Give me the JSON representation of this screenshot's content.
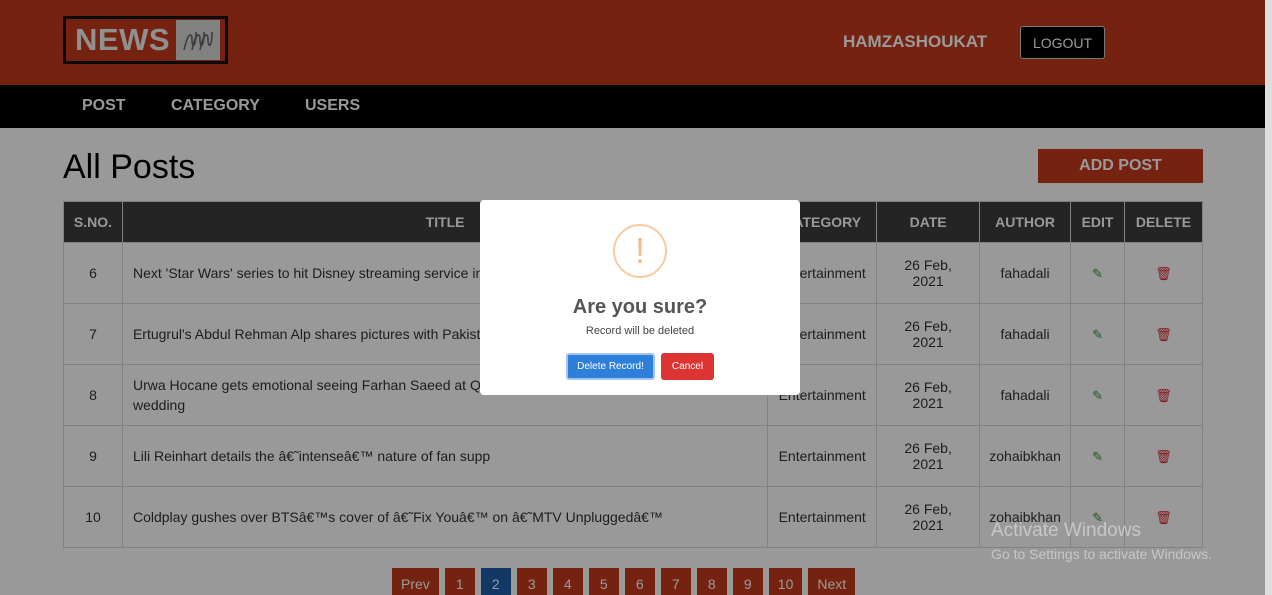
{
  "header": {
    "logo_text": "NEWS",
    "username": "HAMZASHOUKAT",
    "logout_label": "LOGOUT"
  },
  "nav": {
    "items": [
      {
        "label": "POST"
      },
      {
        "label": "CATEGORY"
      },
      {
        "label": "USERS"
      }
    ]
  },
  "main": {
    "title": "All Posts",
    "add_post_label": "ADD POST",
    "table": {
      "headers": [
        "S.NO.",
        "TITLE",
        "CATEGORY",
        "DATE",
        "AUTHOR",
        "EDIT",
        "DELETE"
      ],
      "rows": [
        {
          "sno": "6",
          "title": "Next 'Star Wars' series to hit Disney streaming service in",
          "category": "Entertainment",
          "date_line1": "26 Feb,",
          "date_line2": "2021",
          "author": "fahadali"
        },
        {
          "sno": "7",
          "title": "Ertugrul's Abdul Rehman Alp shares pictures with Pakist",
          "category": "Entertainment",
          "date_line1": "26 Feb,",
          "date_line2": "2021",
          "author": "fahadali"
        },
        {
          "sno": "8",
          "title": "Urwa Hocane gets emotional seeing Farhan Saeed at Q",
          "title_line2": "wedding",
          "category": "Entertainment",
          "date_line1": "26 Feb,",
          "date_line2": "2021",
          "author": "fahadali"
        },
        {
          "sno": "9",
          "title": "Lili Reinhart details the â€˜intenseâ€™ nature of fan supp",
          "category": "Entertainment",
          "date_line1": "26 Feb,",
          "date_line2": "2021",
          "author": "zohaibkhan"
        },
        {
          "sno": "10",
          "title": "Coldplay gushes over BTSâ€™s cover of â€˜Fix Youâ€™ on â€˜MTV Unpluggedâ€™",
          "category": "Entertainment",
          "date_line1": "26 Feb,",
          "date_line2": "2021",
          "author": "zohaibkhan"
        }
      ]
    },
    "pagination": {
      "prev_label": "Prev",
      "next_label": "Next",
      "pages": [
        "1",
        "2",
        "3",
        "4",
        "5",
        "6",
        "7",
        "8",
        "9",
        "10"
      ],
      "active_page": "2"
    }
  },
  "modal": {
    "icon_glyph": "!",
    "title": "Are you sure?",
    "text": "Record will be deleted",
    "confirm_label": "Delete Record!",
    "cancel_label": "Cancel"
  },
  "watermark": {
    "line1": "Activate Windows",
    "line2": "Go to Settings to activate Windows."
  },
  "icons": {
    "edit": "edit-icon",
    "delete": "trash-icon",
    "warning": "exclamation-icon"
  },
  "colors": {
    "brand": "#c4391d",
    "nav": "#000000",
    "active_page": "#1f5fa8",
    "confirm": "#2d7fd9",
    "cancel": "#dc3333",
    "edit_icon": "#2e9a3a",
    "delete_icon": "#d9262c"
  }
}
